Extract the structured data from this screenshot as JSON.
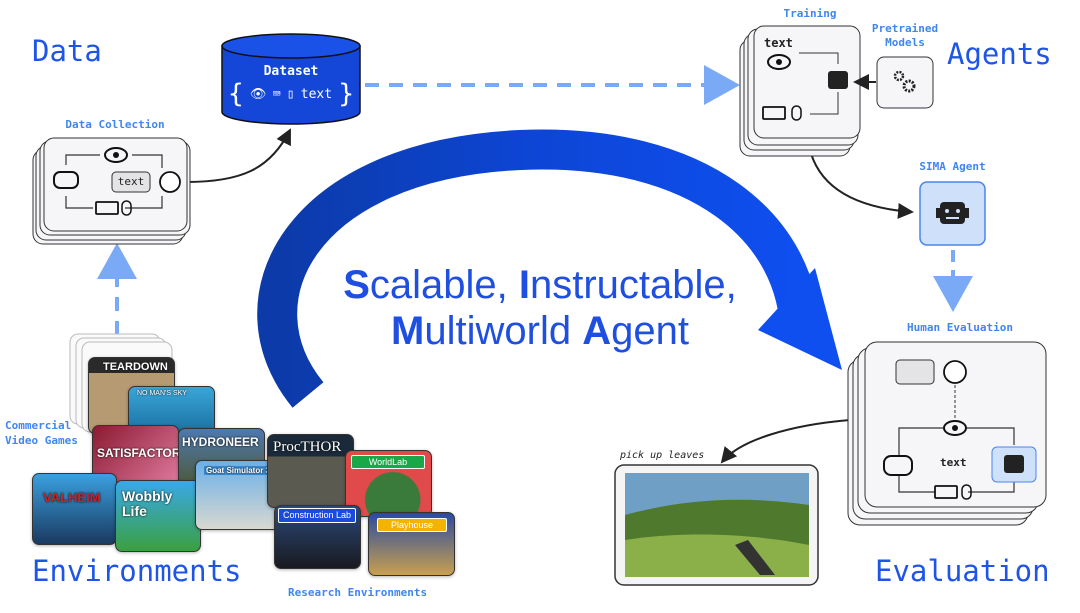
{
  "sections": {
    "data": "Data",
    "agents": "Agents",
    "environments": "Environments",
    "evaluation": "Evaluation"
  },
  "dataset": {
    "title": "Dataset",
    "text": "text",
    "icons": [
      "eye-icon",
      "keyboard-icon",
      "mouse-icon"
    ]
  },
  "data_collection": {
    "label": "Data Collection",
    "text": "text",
    "icons": [
      "eye-icon",
      "gamepad-icon",
      "keyboard-icon",
      "mouse-icon",
      "person-icon"
    ]
  },
  "training": {
    "label": "Training",
    "text": "text",
    "icons": [
      "eye-icon",
      "robot-icon",
      "keyboard-icon",
      "mouse-icon"
    ]
  },
  "pretrained": {
    "label_line1": "Pretrained",
    "label_line2": "Models",
    "icon": "gears-icon"
  },
  "sima_agent": {
    "label": "SIMA Agent",
    "icon": "robot-icon"
  },
  "human_evaluation": {
    "label": "Human Evaluation",
    "text": "text",
    "icons": [
      "thumbs-feedback-icon",
      "person-icon",
      "eye-icon",
      "gamepad-icon",
      "robot-icon",
      "keyboard-icon",
      "mouse-icon"
    ]
  },
  "evaluation_example": {
    "instruction": "pick up leaves"
  },
  "center": {
    "line1": [
      {
        "b": "S",
        "r": "calable, "
      },
      {
        "b": "I",
        "r": "nstructable,"
      }
    ],
    "line2": [
      {
        "b": "M",
        "r": "ultiworld "
      },
      {
        "b": "A",
        "r": "gent"
      }
    ]
  },
  "commercial": {
    "label_line1": "Commercial",
    "label_line2": "Video Games",
    "games": [
      "TEARDOWN",
      "NO MAN'S SKY",
      "SATISFACTORY",
      "HYDRONEER",
      "VALHEIM",
      "Wobbly Life",
      "Goat Simulator 3"
    ]
  },
  "research": {
    "label": "Research Environments",
    "envs": [
      "ProcTHOR",
      "WorldLab",
      "Construction Lab",
      "Playhouse"
    ]
  },
  "colors": {
    "accent": "#1f55e6",
    "arc": "#0a3fc8",
    "light_accent": "#7aaaf5",
    "sima_box": "#cfe0fb"
  }
}
